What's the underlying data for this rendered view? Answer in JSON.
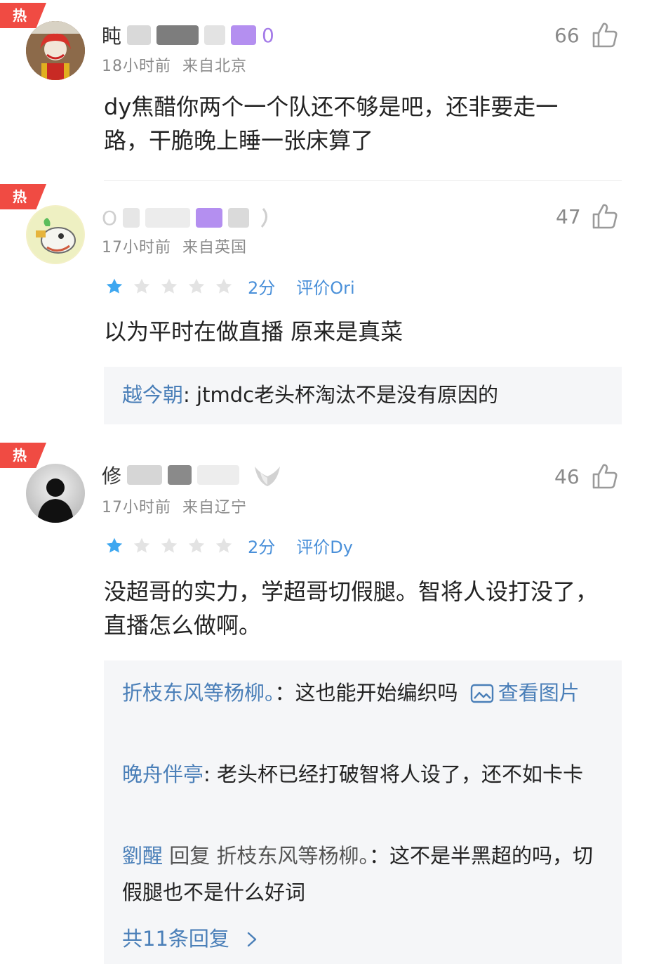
{
  "hot_label": "热",
  "comments": [
    {
      "name_visible_start": "盹",
      "name_visible_end": "0",
      "time": "18小时前",
      "location": "来自北京",
      "likes": "66",
      "content": "dy焦醋你两个一个队还不够是吧，还非要走一路，干脆晚上睡一张床算了"
    },
    {
      "name_visible_start": "O",
      "time": "17小时前",
      "location": "来自英国",
      "likes": "47",
      "rating": {
        "stars": 1,
        "max": 5,
        "score": "2分",
        "target": "评价Ori"
      },
      "content": "以为平时在做直播 原来是真菜",
      "replies": [
        {
          "author": "越今朝",
          "sep": ": ",
          "text": "jtmdc老头杯淘汰不是没有原因的"
        }
      ]
    },
    {
      "name_visible_start": "修",
      "time": "17小时前",
      "location": "来自辽宁",
      "likes": "46",
      "rating": {
        "stars": 1,
        "max": 5,
        "score": "2分",
        "target": "评价Dy"
      },
      "content": "没超哥的实力，学超哥切假腿。智将人设打没了，直播怎么做啊。",
      "replies": [
        {
          "author": "折枝东风等杨柳。",
          "sep": "：",
          "text": "这也能开始编织吗",
          "view_image": "查看图片"
        },
        {
          "author": "晚舟伴亭",
          "sep": ": ",
          "text": "老头杯已经打破智将人设了，还不如卡卡"
        },
        {
          "author": "劉醒",
          "reply_word": "回复",
          "reply_to": "折枝东风等杨柳。",
          "sep": "：",
          "text": "这不是半黑超的吗，切假腿也不是什么好词"
        }
      ],
      "more_replies": "共11条回复"
    }
  ],
  "colors": {
    "hot": "#f04b43",
    "link": "#4a7fb8",
    "star_active": "#3ea7f0",
    "star_inactive": "#e3e3e3",
    "reply_bg": "#f5f6f8"
  }
}
